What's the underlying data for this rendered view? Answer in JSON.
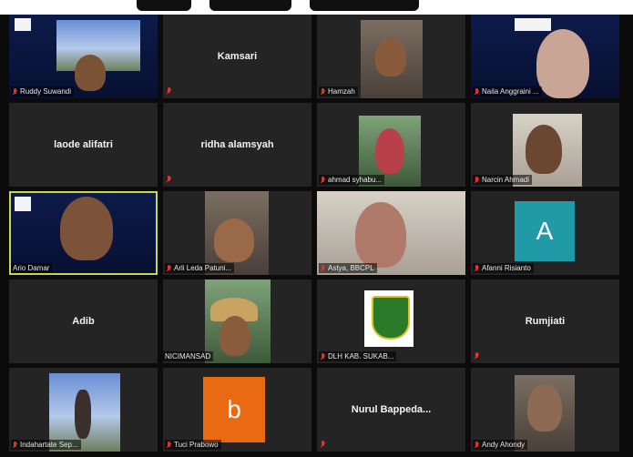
{
  "banner": {
    "alt": "partially visible title text"
  },
  "tiles": [
    {
      "name": "Ruddy Suwandi",
      "kind": "video"
    },
    {
      "name": "Kamsari",
      "kind": "name"
    },
    {
      "name": "Hamzah",
      "kind": "video"
    },
    {
      "name": "Naila Anggraini ...",
      "kind": "video"
    },
    {
      "name": "laode alifatri",
      "kind": "name"
    },
    {
      "name": "ridha alamsyah",
      "kind": "name"
    },
    {
      "name": "ahmad syhabu...",
      "kind": "video"
    },
    {
      "name": "Narcin Ahmadi",
      "kind": "video"
    },
    {
      "name": "Ario Damar",
      "kind": "video",
      "speaking": true
    },
    {
      "name": "Arli Leda Patuni...",
      "kind": "video"
    },
    {
      "name": "Astya, BBCPL",
      "kind": "video"
    },
    {
      "name": "Afanni Risianto",
      "kind": "avatar",
      "letter": "A",
      "color": "#1f9aa6"
    },
    {
      "name": "Adib",
      "kind": "name"
    },
    {
      "name": "NICIMANSAD",
      "kind": "video"
    },
    {
      "name": "DLH KAB. SUKAB...",
      "kind": "logo"
    },
    {
      "name": "Rumjiati",
      "kind": "name"
    },
    {
      "name": "Indahartate Sep...",
      "kind": "video"
    },
    {
      "name": "Tuci Prabowo",
      "kind": "avatar",
      "letter": "b",
      "color": "#ea6a14"
    },
    {
      "name": "Nurul Bappeda...",
      "kind": "name"
    },
    {
      "name": "Andy Ahondy",
      "kind": "video"
    }
  ]
}
